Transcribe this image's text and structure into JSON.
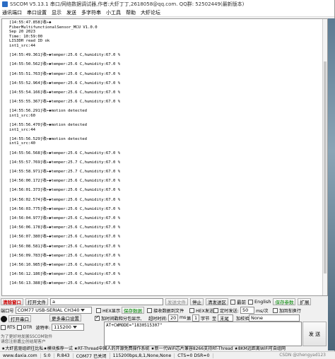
{
  "window": {
    "title": "SSCOM V5.13.1 串口/网络数据调试器,作者:大虾丁丁,2618058@qq.com. QQ群: 52502449(最新版本)",
    "menu": [
      "通讯端口",
      "串口设置",
      "显示",
      "发送",
      "多字符串",
      "小工具",
      "帮助",
      "大虾论坛"
    ]
  },
  "terminal": {
    "lines": [
      "[14:55:47.858]收←◆",
      "FiberMultifunctionalSensor_MCU V1.0.0",
      "Sep 20 2023",
      "Time: 10:59:00",
      "LIS3DH read ID ok",
      "int1_src:44",
      "",
      "[14:55:49.361]收←◆temper:25.6 C,humidity:67.0 %",
      "",
      "[14:55:50.562]收←◆temper:25.6 C,humidity:67.0 %",
      "",
      "[14:55:51.763]收←◆temper:25.6 C,humidity:67.0 %",
      "",
      "[14:55:52.964]收←◆temper:25.6 C,humidity:67.0 %",
      "",
      "[14:55:54.166]收←◆temper:25.6 C,humidity:67.0 %",
      "",
      "[14:55:55.367]收←◆temper:25.6 C,humidity:67.0 %",
      "",
      "[14:55:56.291]收←◆motion detected",
      "int1_src:60",
      "",
      "[14:55:56.470]收←◆motion detected",
      "int1_src:44",
      "",
      "[14:55:56.529]收←◆motion detected",
      "int1_src:40",
      "",
      "[14:55:56.568]收←◆temper:25.6 C,humidity:67.0 %",
      "",
      "[14:55:57.769]收←◆temper:25.7 C,humidity:67.0 %",
      "",
      "[14:55:58.971]收←◆temper:25.7 C,humidity:67.0 %",
      "",
      "[14:56:00.172]收←◆temper:25.6 C,humidity:67.0 %",
      "",
      "[14:56:01.373]收←◆temper:25.6 C,humidity:67.0 %",
      "",
      "[14:56:02.574]收←◆temper:25.6 C,humidity:67.0 %",
      "",
      "[14:56:03.775]收←◆temper:25.6 C,humidity:67.0 %",
      "",
      "[14:56:04.977]收←◆temper:25.6 C,humidity:67.0 %",
      "",
      "[14:56:06.178]收←◆temper:25.6 C,humidity:67.0 %",
      "",
      "[14:56:07.380]收←◆temper:25.6 C,humidity:67.0 %",
      "",
      "[14:56:08.581]收←◆temper:25.6 C,humidity:67.0 %",
      "",
      "[14:56:09.783]收←◆temper:25.6 C,humidity:67.0 %",
      "",
      "[14:56:10.985]收←◆temper:25.6 C,humidity:67.0 %",
      "",
      "[14:56:12.186]收←◆temper:25.6 C,humidity:67.0 %",
      "",
      "[14:56:13.388]收←◆temper:25.6 C,humidity:67.0 %"
    ]
  },
  "toolbar": {
    "clear_window": "清除窗口",
    "open_file": "打开文件",
    "file_path": "a",
    "send_file": "发送文件",
    "stop": "停止",
    "clear_send": "清发送区",
    "last_label": "最前",
    "english": "English",
    "save_params": "保存参数",
    "expand": "扩展"
  },
  "panel": {
    "port_label": "端口号",
    "port_value": "COM77 USB-SERIAL CH340",
    "hex_display": "HEX显示",
    "save_data": "保存数据",
    "recv_to_file": "接收数据到文件",
    "hex_send": "HEX发送",
    "timed_send": "定时发送:",
    "interval": "50",
    "interval_unit": "ms/次",
    "add_crlf": "加回车换行",
    "more_settings": "更多串口设置",
    "add_timestamp": "加时间戳和分包显示,",
    "timeout_label": "超时时间:",
    "timeout_value": "20",
    "timeout_unit": "ms",
    "byte_label": "第",
    "byte_value": "1",
    "byte_unit": "字节",
    "to_label": "至",
    "to_value": "末尾",
    "checksum_label": "加校验",
    "checksum_value": "None",
    "open_port": "打开串口",
    "rts": "RTS",
    "dtr": "DTR",
    "baud_label": "波特率:",
    "baud_value": "115200",
    "send_text": "AT+CWMODE=\"1830515307\"",
    "send_button": "发 送",
    "hint1": "为了更好地发展SSCOM软件",
    "hint2": "请您注册嘉立创结尾客户",
    "promo": "★大虾蓝驱组织往比私★模块推荐一试 ★RT-Thread中国人的开源免费操作系统 ★新一代WiFi芯片兼容8266支持RT-Thread ★8KM远距离WiFi可自组网"
  },
  "status": {
    "website": "www.daxia.com",
    "s": "S:0",
    "r": "R:843",
    "port_state": "COM77 已关闭",
    "params": "115200bps,8,1,None,None",
    "cts": "CTS=0 DSR=0"
  },
  "watermark": "CSDN @zhengyad123"
}
